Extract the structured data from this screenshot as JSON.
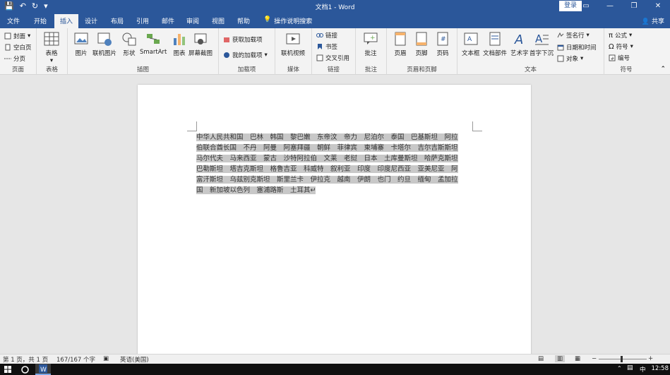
{
  "window": {
    "title": "文档1 - Word",
    "login_label": "登录",
    "controls": [
      "—",
      "❐",
      "✕"
    ]
  },
  "qat": {
    "save_icon": "save-icon",
    "undo_icon": "undo-icon",
    "redo_icon": "redo-icon"
  },
  "tabs": [
    "文件",
    "开始",
    "插入",
    "设计",
    "布局",
    "引用",
    "邮件",
    "审阅",
    "视图",
    "帮助"
  ],
  "active_tab": "插入",
  "tell_me": "操作说明搜索",
  "share": "共享",
  "ribbon": {
    "pages": {
      "label": "页面",
      "items": [
        "封面",
        "空白页",
        "分页"
      ]
    },
    "tables": {
      "label": "表格",
      "items": [
        "表格"
      ]
    },
    "illustrations": {
      "label": "插图",
      "items": [
        "图片",
        "联机图片",
        "形状",
        "SmartArt",
        "图表",
        "屏幕截图"
      ]
    },
    "addins": {
      "label": "加载项",
      "items": [
        "获取加载项",
        "我的加载项"
      ]
    },
    "media": {
      "label": "媒体",
      "items": [
        "联机视频"
      ]
    },
    "links": {
      "label": "链接",
      "items": [
        "链接",
        "书签",
        "交叉引用"
      ]
    },
    "comments": {
      "label": "批注",
      "items": [
        "批注"
      ]
    },
    "header_footer": {
      "label": "页眉和页脚",
      "items": [
        "页眉",
        "页脚",
        "页码"
      ]
    },
    "text": {
      "label": "文本",
      "items": [
        "文本框",
        "文档部件",
        "艺术字",
        "首字下沉"
      ],
      "side": [
        "签名行",
        "日期和时间",
        "对象"
      ]
    },
    "symbols": {
      "label": "符号",
      "items": [
        "公式",
        "符号",
        "编号"
      ]
    }
  },
  "document": {
    "lines": [
      "中华人民共和国　巴林　韩国　黎巴嫩　东帝汶　帝力　尼泊尔　泰国　巴基斯坦　阿拉",
      "伯联合酋长国　不丹　阿曼　阿塞拜疆　朝鲜　菲律宾　柬埔寨　卡塔尔　吉尔吉斯斯坦",
      "马尔代夫　马来西亚　蒙古　沙特阿拉伯　文莱　老挝　日本　土库曼斯坦　哈萨克斯坦",
      "巴勒斯坦　塔吉克斯坦　格鲁吉亚　科威特　叙利亚　印度　印度尼西亚　亚美尼亚　阿",
      "富汗斯坦　乌兹别克斯坦　斯里兰卡　伊拉克　越南　伊朗　也门　约旦　缅甸　孟加拉",
      "国　新加坡以色列　塞浦路斯　土耳其↵"
    ]
  },
  "status": {
    "page": "第 1 页，共 1 页",
    "words": "167/167 个字",
    "language": "英语(美国)"
  },
  "taskbar": {
    "ime": "中",
    "time": "12:58"
  },
  "colors": {
    "accent": "#2b579a",
    "ribbon_bg": "#f3f3f3",
    "selection": "#c8c8c8"
  }
}
